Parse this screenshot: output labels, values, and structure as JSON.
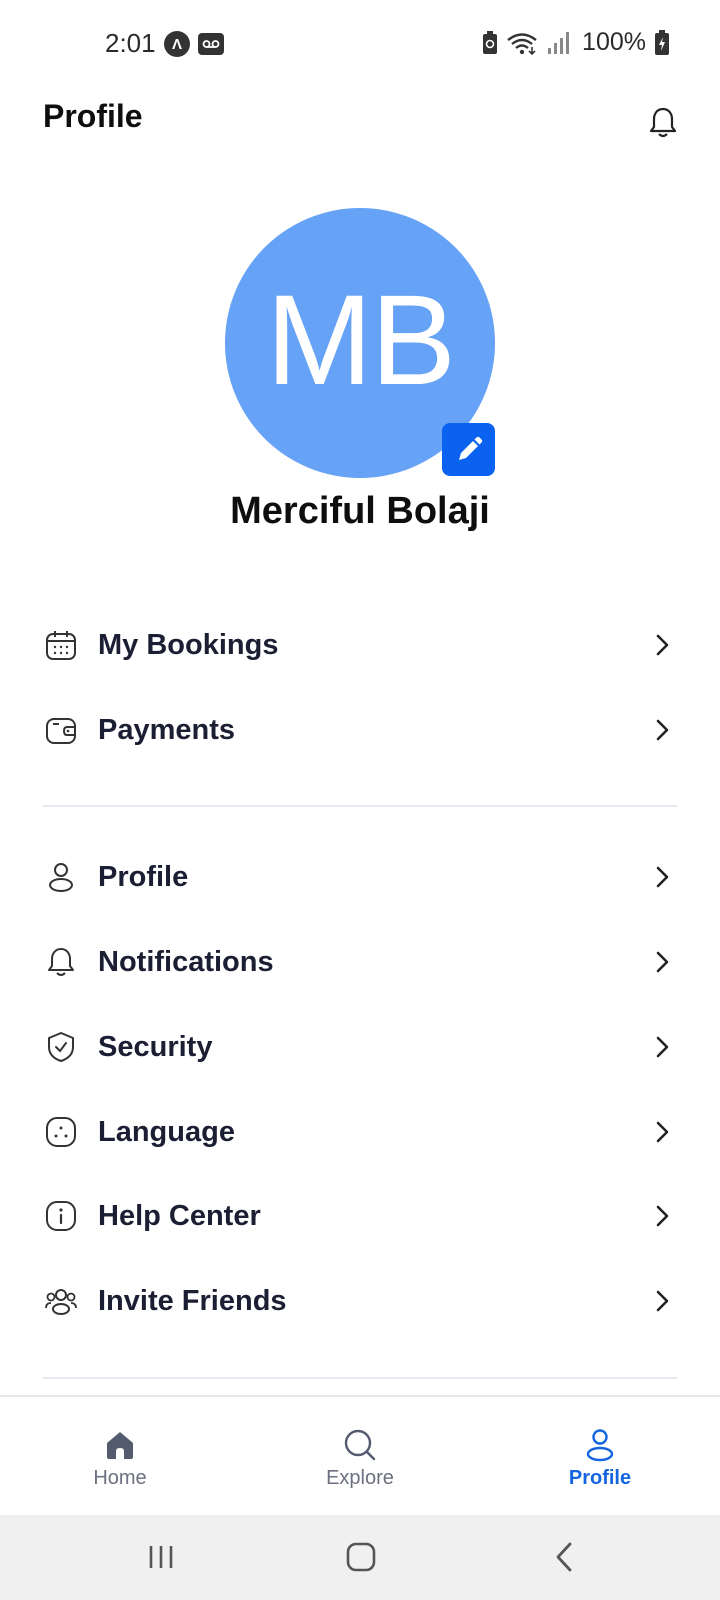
{
  "status_bar": {
    "time": "2:01",
    "battery": "100%",
    "icons": [
      "a-circle-icon",
      "voicemail-icon",
      "battery-saver-icon",
      "wifi-icon",
      "signal-icon",
      "battery-charging-icon"
    ]
  },
  "header": {
    "title": "Profile",
    "notification_icon": "bell-icon"
  },
  "user": {
    "initials": "MB",
    "name": "Merciful Bolaji",
    "avatar_color": "#66a2f6",
    "edit_icon": "pencil-icon"
  },
  "menu_groups": [
    {
      "items": [
        {
          "label": "My Bookings",
          "icon": "calendar-icon"
        },
        {
          "label": "Payments",
          "icon": "wallet-icon"
        }
      ]
    },
    {
      "items": [
        {
          "label": "Profile",
          "icon": "user-icon"
        },
        {
          "label": "Notifications",
          "icon": "bell-icon"
        },
        {
          "label": "Security",
          "icon": "shield-check-icon"
        },
        {
          "label": "Language",
          "icon": "language-icon"
        },
        {
          "label": "Help Center",
          "icon": "info-icon"
        },
        {
          "label": "Invite Friends",
          "icon": "users-icon"
        }
      ]
    }
  ],
  "bottom_nav": {
    "items": [
      {
        "label": "Home",
        "icon": "home-icon",
        "active": false
      },
      {
        "label": "Explore",
        "icon": "search-icon",
        "active": false
      },
      {
        "label": "Profile",
        "icon": "user-icon",
        "active": true
      }
    ]
  },
  "colors": {
    "accent": "#1565e0",
    "edit_button": "#0b62f0",
    "text_primary": "#1c1f33"
  }
}
